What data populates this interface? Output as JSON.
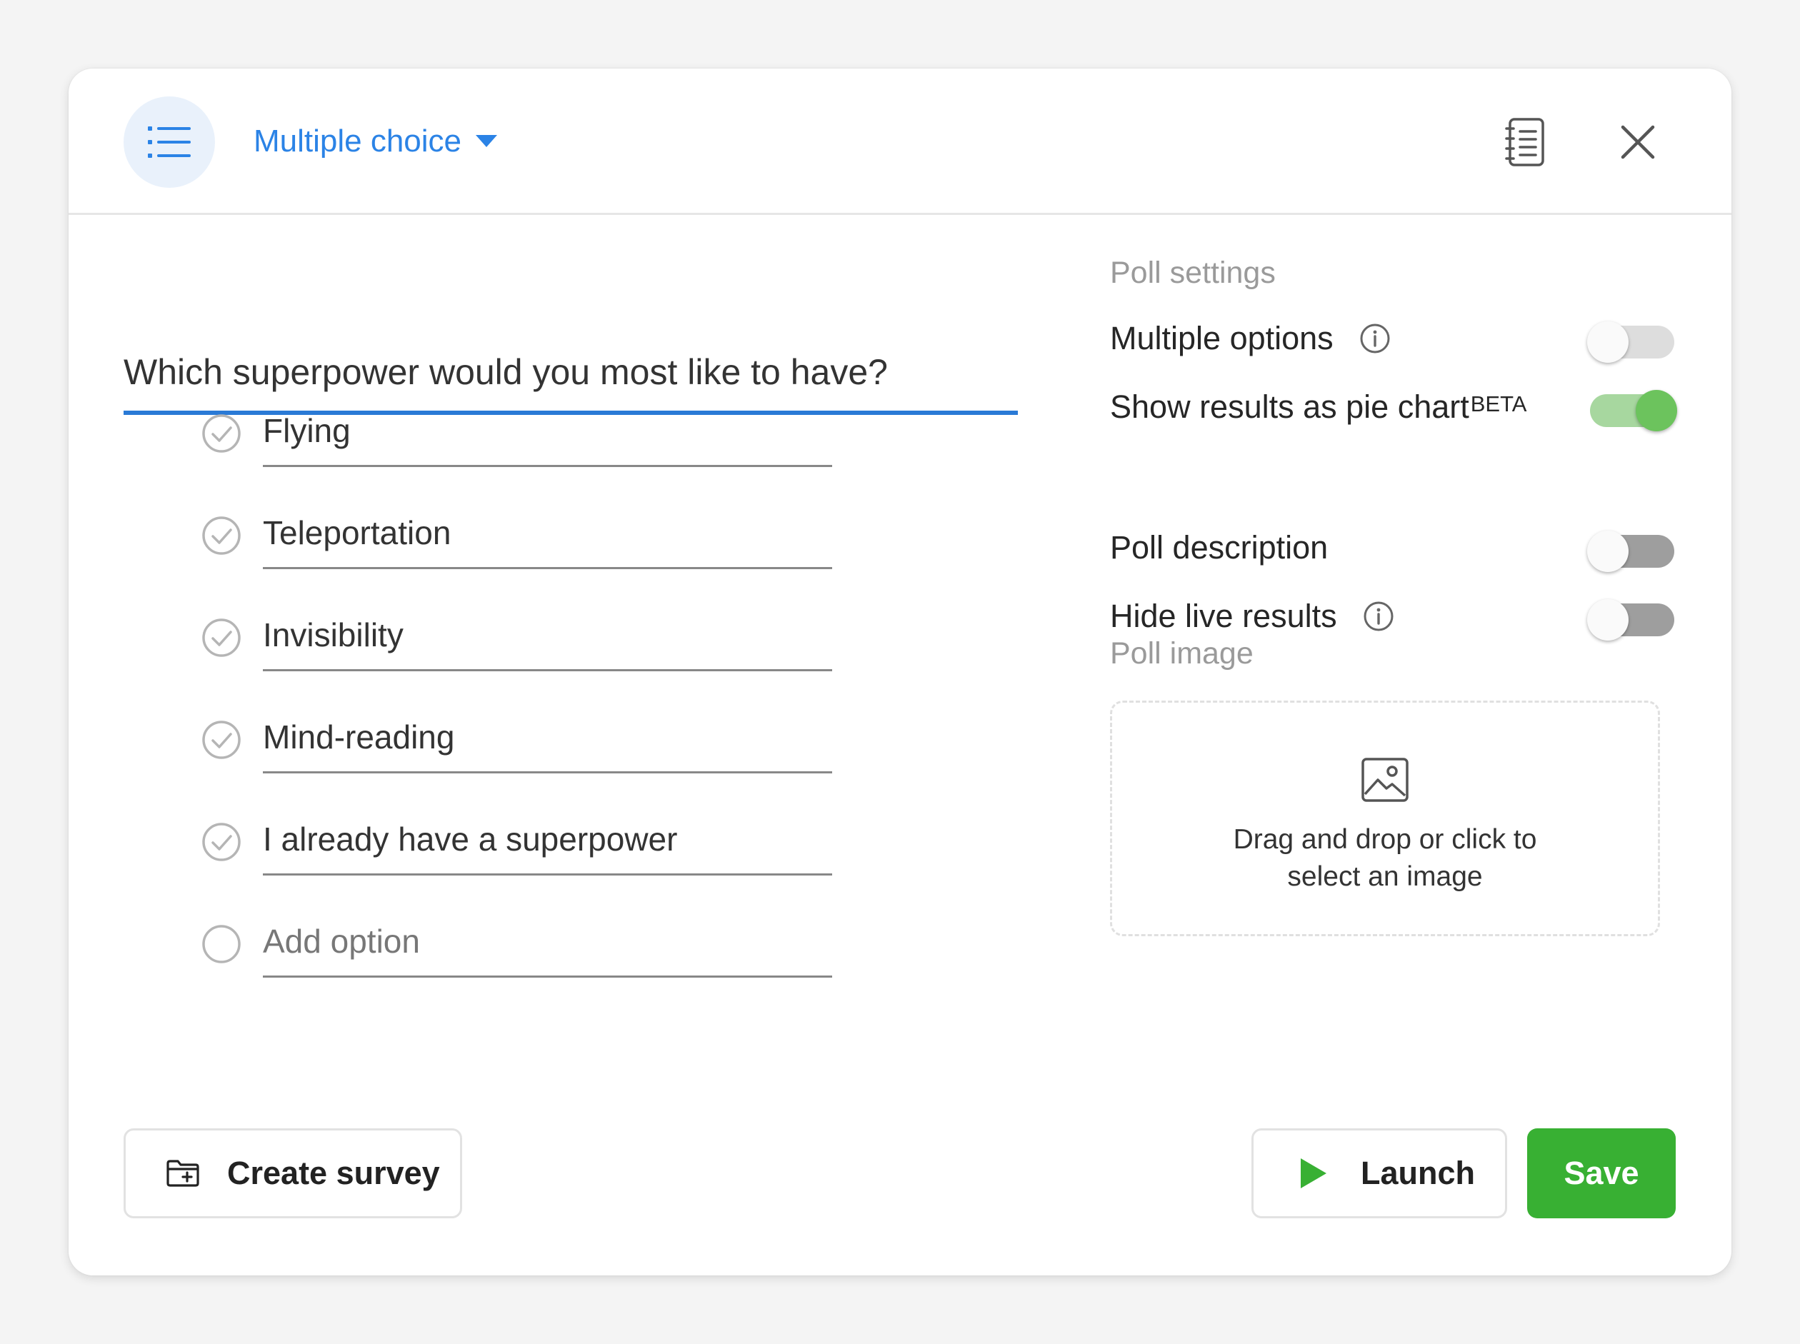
{
  "header": {
    "type_label": "Multiple choice",
    "icons": {
      "type": "list-icon",
      "dropdown": "caret-down-icon",
      "doc": "notebook-icon",
      "close": "close-icon"
    },
    "accent_color": "#2b83e6"
  },
  "question": {
    "text": "Which superpower would you most like to have?"
  },
  "options": [
    {
      "label": "Flying"
    },
    {
      "label": "Teleportation"
    },
    {
      "label": "Invisibility"
    },
    {
      "label": "Mind-reading"
    },
    {
      "label": "I already have a superpower"
    }
  ],
  "add_option": {
    "placeholder": "Add option"
  },
  "settings": {
    "title": "Poll settings",
    "items": [
      {
        "label": "Multiple options",
        "info": true,
        "enabled": false
      },
      {
        "label": "Show results as pie chart",
        "badge": "BETA",
        "enabled": true
      },
      {
        "label": "Poll description",
        "enabled": false
      },
      {
        "label": "Hide live results",
        "info": true,
        "enabled": false
      }
    ],
    "on_color": "#6cc35d"
  },
  "image": {
    "title": "Poll image",
    "dropzone_line1": "Drag and drop or click to",
    "dropzone_line2": "select an image"
  },
  "footer": {
    "create_label": "Create survey",
    "launch_label": "Launch",
    "save_label": "Save",
    "save_color": "#38b033",
    "launch_icon_color": "#38b033"
  }
}
